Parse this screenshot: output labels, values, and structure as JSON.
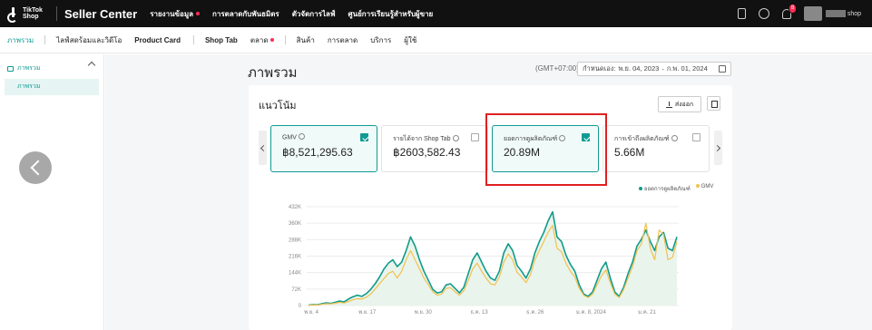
{
  "topbar": {
    "logo_line1": "TikTok",
    "logo_line2": "Shop",
    "brand": "Seller Center",
    "nav": [
      {
        "label": "รายงานข้อมูล",
        "dot": true
      },
      {
        "label": "การตลาดกับพันธมิตร",
        "dot": false
      },
      {
        "label": "ตัวจัดการไลฟ์",
        "dot": false
      },
      {
        "label": "ศูนย์การเรียนรู้สำหรับผู้ขาย",
        "dot": false
      }
    ],
    "notification_count": "8",
    "shop_name": "shop"
  },
  "subnav": {
    "items": [
      "ภาพรวม",
      "ไลฟ์สดร้อมและวิดีโอ",
      "Product Card",
      "Shop Tab",
      "ตลาด",
      "สินค้า",
      "การตลาด",
      "บริการ",
      "ผู้ใช้"
    ]
  },
  "sidebar": {
    "section": "ภาพรวม",
    "item": "ภาพรวม"
  },
  "header": {
    "title": "ภาพรวม",
    "timezone": "(GMT+07:00)",
    "date_label": "กำหนดเอง:",
    "date_start": "พ.ย. 04, 2023",
    "date_sep": "-",
    "date_end": "ก.พ. 01, 2024"
  },
  "trend": {
    "title": "แนวโน้ม",
    "export_label": "ส่งออก"
  },
  "metrics": [
    {
      "label": "GMV",
      "value": "฿8,521,295.63",
      "checked": true,
      "selected": true
    },
    {
      "label": "รายได้จาก Shop Tab",
      "value": "฿2603,582.43",
      "checked": false,
      "selected": false
    },
    {
      "label": "ยอดการดูผลิตภัณฑ์",
      "value": "20.89M",
      "checked": true,
      "selected": true
    },
    {
      "label": "การเข้าถึงผลิตภัณฑ์",
      "value": "5.66M",
      "checked": false,
      "selected": false
    }
  ],
  "colors": {
    "accent": "#0f9b93",
    "gmv_line": "#f2c14e",
    "views_line": "#119b8c",
    "highlight": "#e02020",
    "topbar": "#111111"
  },
  "chart_data": {
    "type": "line",
    "yticks": [
      "432K",
      "360K",
      "288K",
      "216K",
      "144K",
      "72K",
      "0"
    ],
    "ylim": [
      0,
      432000
    ],
    "xticks": [
      "พ.ย. 4",
      "พ.ย. 17",
      "พ.ย. 30",
      "ธ.ค. 13",
      "ธ.ค. 26",
      "ม.ค. 8, 2024",
      "ม.ค. 21"
    ],
    "legend": [
      "ยอดการดูผลิตภัณฑ์",
      "GMV"
    ],
    "legend_position": "top-right",
    "grid": true,
    "series": [
      {
        "name": "ยอดการดูผลิตภัณฑ์",
        "values": [
          2000,
          4000,
          3000,
          8000,
          12000,
          9000,
          14000,
          20000,
          16000,
          28000,
          38000,
          45000,
          40000,
          52000,
          70000,
          95000,
          125000,
          160000,
          185000,
          200000,
          170000,
          190000,
          240000,
          300000,
          260000,
          200000,
          150000,
          110000,
          70000,
          55000,
          60000,
          90000,
          95000,
          75000,
          55000,
          80000,
          140000,
          200000,
          230000,
          190000,
          150000,
          120000,
          110000,
          150000,
          230000,
          270000,
          240000,
          175000,
          150000,
          120000,
          160000,
          230000,
          280000,
          320000,
          370000,
          410000,
          300000,
          280000,
          220000,
          180000,
          150000,
          90000,
          50000,
          40000,
          60000,
          110000,
          160000,
          190000,
          120000,
          60000,
          40000,
          80000,
          140000,
          190000,
          260000,
          290000,
          330000,
          280000,
          240000,
          300000,
          320000,
          250000,
          240000,
          300000
        ]
      },
      {
        "name": "GMV",
        "values": [
          1000,
          2000,
          2000,
          5000,
          8000,
          7000,
          10000,
          14000,
          11000,
          18000,
          25000,
          30000,
          28000,
          36000,
          50000,
          72000,
          95000,
          118000,
          140000,
          150000,
          120000,
          150000,
          200000,
          240000,
          200000,
          160000,
          120000,
          90000,
          60000,
          45000,
          50000,
          75000,
          78000,
          60000,
          45000,
          65000,
          110000,
          160000,
          185000,
          150000,
          120000,
          95000,
          90000,
          125000,
          190000,
          225000,
          200000,
          145000,
          125000,
          100000,
          135000,
          200000,
          240000,
          280000,
          320000,
          350000,
          250000,
          235000,
          185000,
          150000,
          125000,
          75000,
          45000,
          35000,
          50000,
          90000,
          130000,
          155000,
          100000,
          50000,
          35000,
          70000,
          120000,
          170000,
          240000,
          270000,
          360000,
          250000,
          200000,
          330000,
          310000,
          200000,
          210000,
          280000
        ]
      }
    ]
  }
}
